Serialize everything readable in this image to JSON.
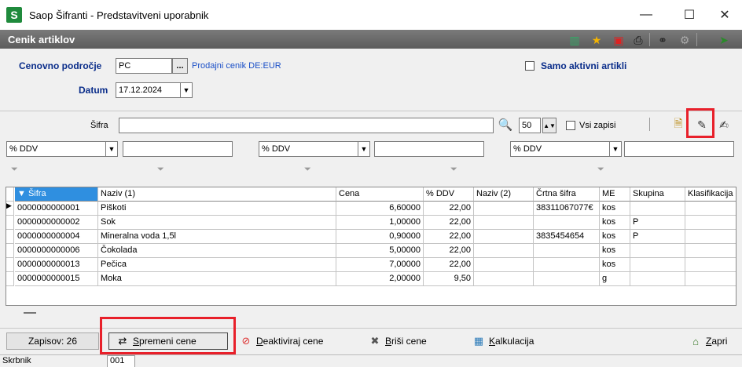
{
  "window": {
    "logo_letter": "S",
    "title": "Saop Šifranti  - Predstavitveni uporabnik",
    "minimize": "—",
    "maximize": "☐",
    "close": "✕"
  },
  "header": {
    "title": "Cenik artiklov"
  },
  "filters": {
    "price_area_label": "Cenovno področje",
    "price_area_value": "PC",
    "ellipsis": "...",
    "price_list_link": "Prodajni cenik  DE:EUR",
    "active_only_label": "Samo aktivni artikli",
    "date_label": "Datum",
    "date_value": "17.12.2024"
  },
  "search": {
    "sifra_label": "Šifra",
    "sifra_value": "",
    "count_value": "50",
    "all_records_label": "Vsi zapisi",
    "ddv_filters": [
      "% DDV",
      "% DDV",
      "% DDV"
    ]
  },
  "grid": {
    "columns": [
      "Šifra",
      "Naziv (1)",
      "Cena",
      "% DDV",
      "Naziv (2)",
      "Črtna šifra",
      "ME",
      "Skupina",
      "Klasifikacija"
    ],
    "rows": [
      [
        "0000000000001",
        "Piškoti",
        "6,60000",
        "22,00",
        "",
        "38311067077€",
        "kos",
        "",
        ""
      ],
      [
        "0000000000002",
        "Sok",
        "1,00000",
        "22,00",
        "",
        "",
        "kos",
        "P",
        ""
      ],
      [
        "0000000000004",
        "Mineralna voda 1,5l",
        "0,90000",
        "22,00",
        "",
        "3835454654",
        "kos",
        "P",
        ""
      ],
      [
        "0000000000006",
        "Čokolada",
        "5,00000",
        "22,00",
        "",
        "",
        "kos",
        "",
        ""
      ],
      [
        "0000000000013",
        "Pečica",
        "7,00000",
        "22,00",
        "",
        "",
        "kos",
        "",
        ""
      ],
      [
        "0000000000015",
        "Moka",
        "2,00000",
        "9,50",
        "",
        "",
        "g",
        "",
        ""
      ]
    ]
  },
  "bottom": {
    "records": "Zapisov: 26",
    "change_prices_u": "S",
    "change_prices_rest": "premeni cene",
    "deactivate_u": "D",
    "deactivate_rest": "eaktiviraj cene",
    "delete_u": "B",
    "delete_rest": "riši cene",
    "calc_u": "K",
    "calc_rest": "alkulacija",
    "close_u": "Z",
    "close_rest": "apri"
  },
  "status": {
    "label": "Skrbnik",
    "value": "001"
  },
  "colors": {
    "accent": "#2f8fe0",
    "header_label": "#0a2d8a",
    "highlight": "#e8202a"
  }
}
